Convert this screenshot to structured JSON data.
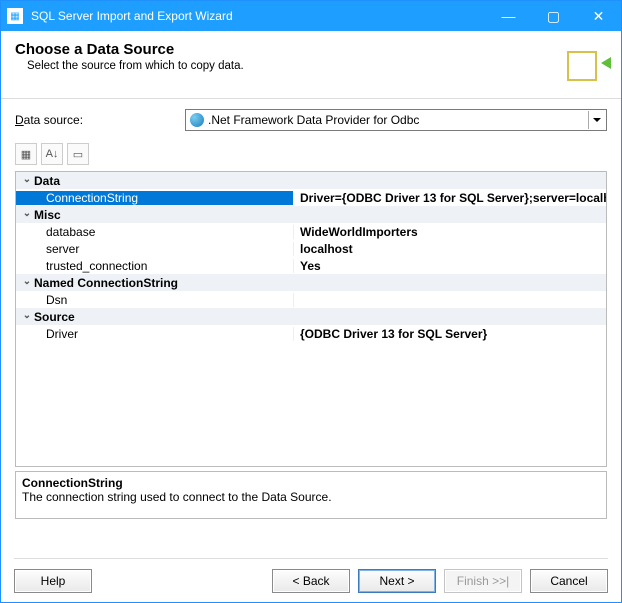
{
  "window": {
    "title": "SQL Server Import and Export Wizard"
  },
  "header": {
    "title": "Choose a Data Source",
    "subtitle": "Select the source from which to copy data."
  },
  "datasource": {
    "label_prefix": "D",
    "label_rest": "ata source:",
    "selected": ".Net Framework Data Provider for Odbc"
  },
  "propgrid": {
    "categories": [
      {
        "name": "Data",
        "rows": [
          {
            "name": "ConnectionString",
            "value": "Driver={ODBC Driver 13 for SQL Server};server=localh",
            "bold": true,
            "selected": true
          }
        ]
      },
      {
        "name": "Misc",
        "rows": [
          {
            "name": "database",
            "value": "WideWorldImporters",
            "bold": true
          },
          {
            "name": "server",
            "value": "localhost",
            "bold": true
          },
          {
            "name": "trusted_connection",
            "value": "Yes",
            "bold": true
          }
        ]
      },
      {
        "name": "Named ConnectionString",
        "rows": [
          {
            "name": "Dsn",
            "value": ""
          }
        ]
      },
      {
        "name": "Source",
        "rows": [
          {
            "name": "Driver",
            "value": "{ODBC Driver 13 for SQL Server}",
            "bold": true
          }
        ]
      }
    ]
  },
  "description": {
    "title": "ConnectionString",
    "text": "The connection string used to connect to the Data Source."
  },
  "buttons": {
    "help": "Help",
    "back": "< Back",
    "next": "Next >",
    "finish": "Finish >>|",
    "cancel": "Cancel"
  }
}
